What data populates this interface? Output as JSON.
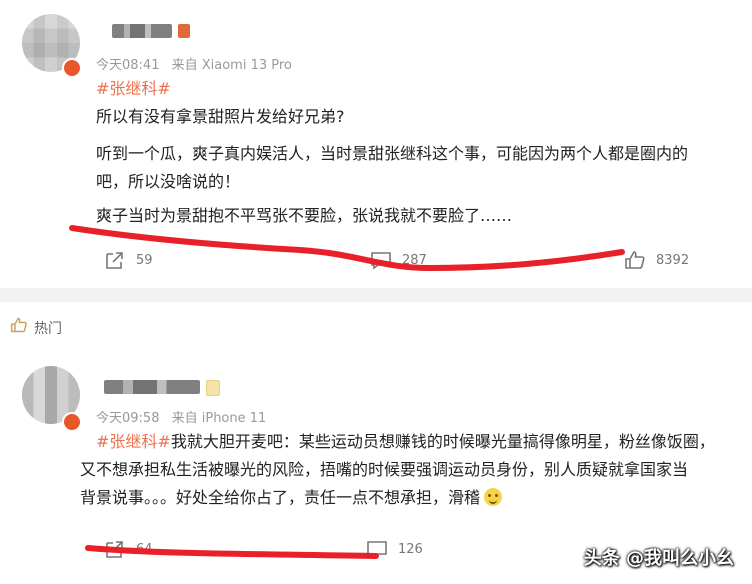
{
  "post1": {
    "time": "今天08:41",
    "source": "来自 Xiaomi 13 Pro",
    "hashtag": "#张继科#",
    "lines": [
      "所以有没有拿景甜照片发给好兄弟?",
      "听到一个瓜，爽子真内娱活人，当时景甜张继科这个事，可能因为两个人都是圈内的",
      "吧，所以没啥说的！",
      "爽子当时为景甜抱不平骂张不要脸，张说我就不要脸了……"
    ],
    "share_count": "59",
    "comment_count": "287",
    "like_count": "8392"
  },
  "section": {
    "label": "热门",
    "icon": "thumbs-up-icon"
  },
  "post2": {
    "time": "今天09:58",
    "source": "来自 iPhone 11",
    "hashtag": "#张继科#",
    "line1_rest": "我就大胆开麦吧：某些运动员想赚钱的时候曝光量搞得像明星，粉丝像饭圈，",
    "line2": "又不想承担私生活被曝光的风险，捂嘴的时候要强调运动员身份，别人质疑就拿国家当",
    "line3": "背景说事。。。好处全给你占了，责任一点不想承担，滑稽",
    "share_count": "64",
    "comment_count": "126"
  },
  "watermark": "头条 @我叫么小幺",
  "colors": {
    "hashtag": "#eb7350",
    "underline": "#e8202a",
    "meta": "#999999"
  }
}
